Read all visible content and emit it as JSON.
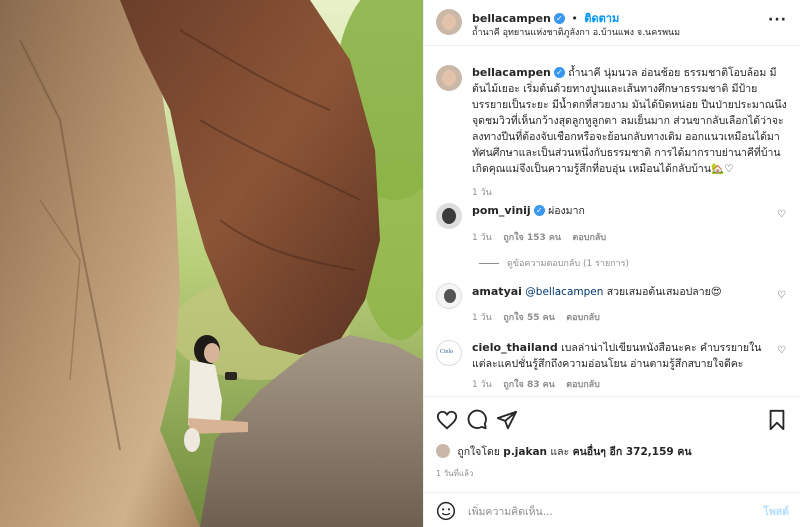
{
  "post": {
    "username": "bellacampen",
    "follow_separator": "•",
    "follow_label": "ติดตาม",
    "location": "ถ้ำนาคี อุทยานแห่งชาติภูลังกา อ.บ้านแพง จ.นครพนม",
    "more_label": "···"
  },
  "caption": {
    "username": "bellacampen",
    "text": "ถ้ำนาคี นุ่มนวล อ่อนช้อย ธรรมชาติโอบล้อม มีต้นไม้เยอะ เริ่มต้นด้วยทางปูนและเส้นทางศึกษาธรรมชาติ มีป้ายบรรยายเป็นระยะ มีน้ำตกที่สวยงาม มันได้บิดหน่อย ปีนป่ายประมาณนึง จุดชมวิวที่เห็นกว้างสุดลูกหูลูกตา ลมเย็นมาก ส่วนขากลับเลือกได้ว่าจะลงทางปีนที่ต้องจับเชือกหรือจะย้อนกลับทางเดิม ออกแนวเหมือนได้มาทัศนศึกษาและเป็นส่วนหนึ่งกับธรรมชาติ การได้มากราบย่านาคีที่บ้านเกิดคุณแม่จึงเป็นความรู้สึกที่อบอุ่น เหมือนได้กลับบ้าน🏡♡",
    "time": "1 วัน"
  },
  "comments": [
    {
      "username": "pom_vinij",
      "verified": true,
      "text": "ผ่องมาก",
      "time": "1 วัน",
      "likes": "ถูกใจ 153 คน",
      "reply": "ตอบกลับ",
      "view_replies": "ดูข้อความตอบกลับ (1 รายการ)"
    },
    {
      "username": "amatyai",
      "mention": "@bellacampen",
      "text": "สวยเสมอต้นเสมอปลาย😍",
      "time": "1 วัน",
      "likes": "ถูกใจ 55 คน",
      "reply": "ตอบกลับ"
    },
    {
      "username": "cielo_thailand",
      "avatar_text": "Cielo",
      "text": "เบลล่าน่าไปเขียนหนังสือนะคะ คำบรรยายในแต่ละแคปชั่นรู้สึกถึงความอ่อนโยน อ่านตามรู้สึกสบายใจดีคะ",
      "time": "1 วัน",
      "likes": "ถูกใจ 83 คน",
      "reply": "ตอบกลับ"
    }
  ],
  "likes_summary": {
    "prefix": "ถูกใจโดย",
    "first_user": "p.jakan",
    "and": "และ",
    "others": "คนอื่นๆ อีก 372,159 คน"
  },
  "date": "1 วันที่แล้ว",
  "add_comment": {
    "placeholder": "เพิ่มความคิดเห็น...",
    "post_label": "โพสต์"
  },
  "icons": {
    "heart": "heart-icon",
    "comment": "comment-icon",
    "share": "share-icon",
    "save": "bookmark-icon",
    "emoji": "emoji-icon"
  },
  "colors": {
    "accent": "#0095f6",
    "verified": "#3897f0",
    "muted": "#8e8e8e",
    "like_heart": "#ed4956"
  }
}
